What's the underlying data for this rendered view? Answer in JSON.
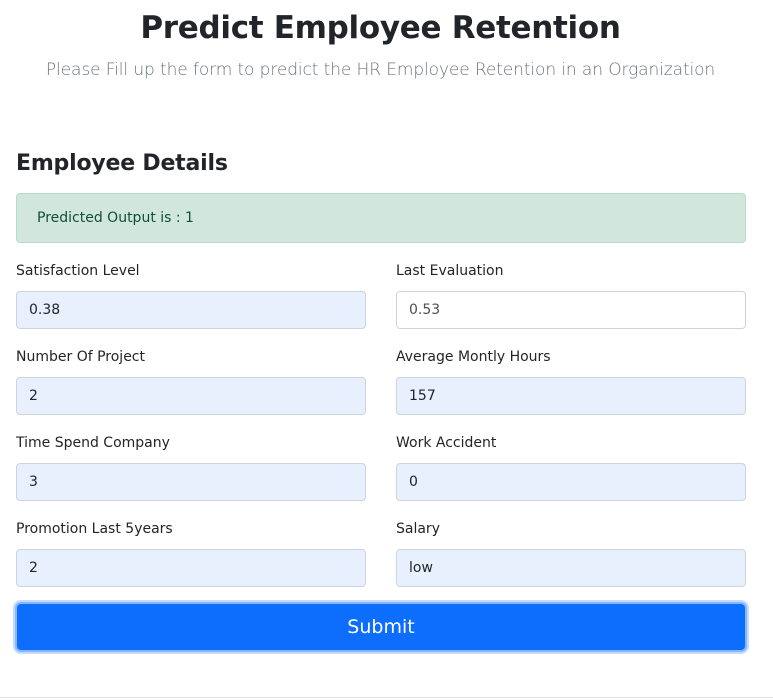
{
  "header": {
    "title": "Predict Employee Retention",
    "subtitle": "Please Fill up the form to predict the HR Employee Retention in an Organization"
  },
  "section": {
    "title": "Employee Details"
  },
  "alert": {
    "text": "Predicted Output is : 1",
    "color": "#0f5132",
    "background": "#d1e7dd"
  },
  "form": {
    "satisfaction_level": {
      "label": "Satisfaction Level",
      "value": "0.38"
    },
    "last_evaluation": {
      "label": "Last Evaluation",
      "value": "0.53"
    },
    "number_project": {
      "label": "Number Of Project",
      "value": "2"
    },
    "average_montly_hours": {
      "label": "Average Montly Hours",
      "value": "157"
    },
    "time_spend_company": {
      "label": "Time Spend Company",
      "value": "3"
    },
    "work_accident": {
      "label": "Work Accident",
      "value": "0"
    },
    "promotion_last_5years": {
      "label": "Promotion Last 5years",
      "value": "2"
    },
    "salary": {
      "label": "Salary",
      "value": "low"
    }
  },
  "submit": {
    "label": "Submit",
    "color": "#0d6efd"
  }
}
